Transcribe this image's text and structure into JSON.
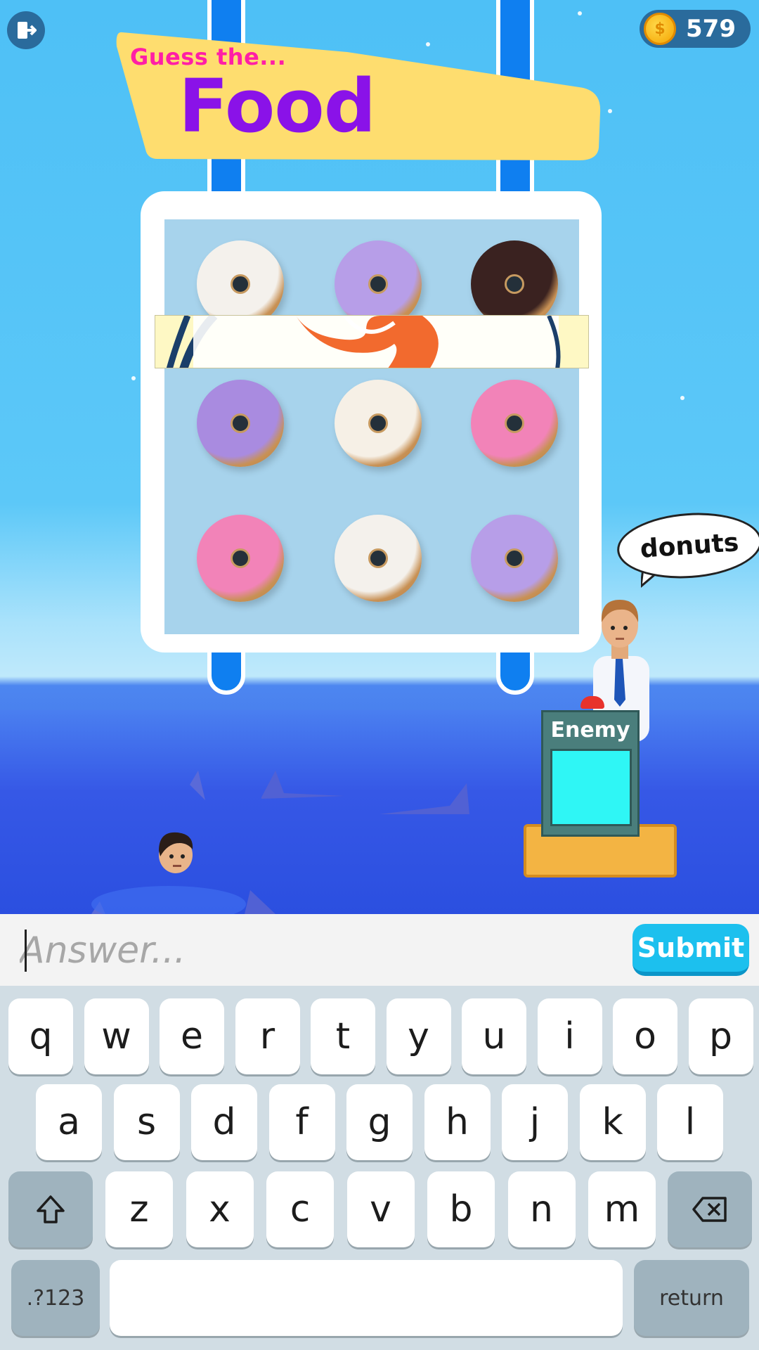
{
  "hud": {
    "exit_icon": "exit-door-icon",
    "coin_icon": "coin-icon",
    "coin_symbol": "$",
    "coins": "579"
  },
  "title": {
    "prefix": "Guess the...",
    "category": "Food"
  },
  "board": {
    "donuts": [
      {
        "row": 0,
        "col": 0,
        "color": "#f4f1ec",
        "icing": "white-coconut"
      },
      {
        "row": 0,
        "col": 1,
        "color": "#b79ee8",
        "icing": "purple-sprinkles"
      },
      {
        "row": 0,
        "col": 2,
        "color": "#3a2220",
        "icing": "chocolate-drizzle"
      },
      {
        "row": 1,
        "col": 0,
        "color": "#a98be0",
        "icing": "purple-drizzle"
      },
      {
        "row": 1,
        "col": 1,
        "color": "#f6f0e6",
        "icing": "white-chocolate-sprinkles"
      },
      {
        "row": 1,
        "col": 2,
        "color": "#f283b8",
        "icing": "pink-drizzle"
      },
      {
        "row": 2,
        "col": 0,
        "color": "#f283b8",
        "icing": "pink-drizzle"
      },
      {
        "row": 2,
        "col": 1,
        "color": "#f4f1ec",
        "icing": "white-coconut"
      },
      {
        "row": 2,
        "col": 2,
        "color": "#b79ee8",
        "icing": "purple-sprinkles"
      }
    ]
  },
  "enemy": {
    "label": "Enemy",
    "guess": "donuts"
  },
  "answer": {
    "placeholder": "Answer...",
    "value": "",
    "submit_label": "Submit"
  },
  "keyboard": {
    "row1": [
      "q",
      "w",
      "e",
      "r",
      "t",
      "y",
      "u",
      "i",
      "o",
      "p"
    ],
    "row2": [
      "a",
      "s",
      "d",
      "f",
      "g",
      "h",
      "j",
      "k",
      "l"
    ],
    "row3": [
      "z",
      "x",
      "c",
      "v",
      "b",
      "n",
      "m"
    ],
    "shift_icon": "shift-arrow-icon",
    "backspace_icon": "backspace-icon",
    "numbers_label": ".?123",
    "space_label": "",
    "return_label": "return"
  },
  "colors": {
    "sky": "#4ec0f6",
    "ocean": "#2f59e0",
    "banner": "#fedd6f",
    "title_pink": "#ff1ea6",
    "title_purple": "#8a12e8",
    "submit": "#1cc0ee"
  }
}
